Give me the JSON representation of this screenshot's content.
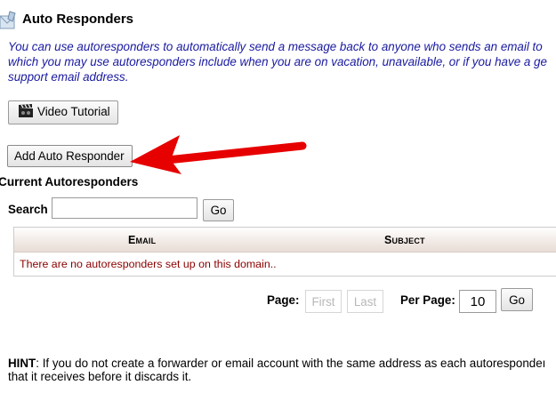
{
  "header": {
    "title": "Auto Responders"
  },
  "intro": {
    "line1": "You can use autoresponders to automatically send a message back to anyone who sends an email to",
    "line2": "which you may use autoresponders include when you are on vacation, unavailable, or if you have a ge",
    "line3": "support email address."
  },
  "buttons": {
    "video_tutorial": "Video Tutorial",
    "add_auto_responder": "Add Auto Responder"
  },
  "section": {
    "title": "Current Autoresponders"
  },
  "search": {
    "label": "Search",
    "value": "",
    "go_label": "Go"
  },
  "table": {
    "columns": [
      "Email",
      "Subject"
    ],
    "empty_message": "There are no autoresponders set up on this domain.."
  },
  "pagination": {
    "page_label": "Page:",
    "first_label": "First",
    "last_label": "Last",
    "per_page_label": "Per Page:",
    "per_page_value": "10",
    "go_label": "Go"
  },
  "hint": {
    "label": "HINT",
    "line1": ": If you do not create a forwarder or email account with the same address as each autorespondeı",
    "line2": "that it receives before it discards it."
  },
  "colors": {
    "intro_text": "#1a1aa0",
    "empty_message": "#8b0000",
    "arrow": "#e60000"
  }
}
